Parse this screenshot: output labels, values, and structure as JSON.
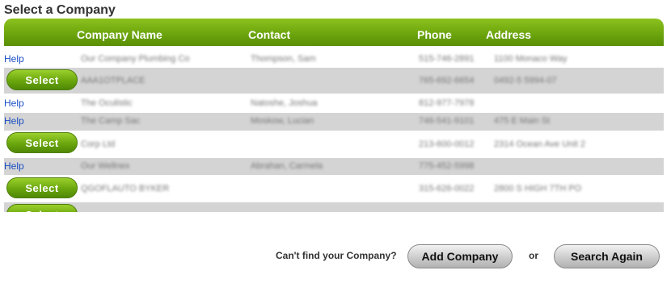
{
  "page_title": "Select a Company",
  "table": {
    "headers": {
      "name": "Company Name",
      "contact": "Contact",
      "phone": "Phone",
      "address": "Address"
    },
    "rows": [
      {
        "type": "help",
        "action": "Help",
        "name": "Our Company Plumbing Co",
        "contact": "Thompson, Sam",
        "phone": "515-746-2891",
        "address": "1100 Monaco Way"
      },
      {
        "type": "select",
        "action": "Select",
        "name": "AAA1OTPLACE",
        "contact": "",
        "phone": "765-692-6654",
        "address": "0492-5 5994-07"
      },
      {
        "type": "help",
        "action": "Help",
        "name": "The Oculistic",
        "contact": "Natoshe, Joshua",
        "phone": "812-977-7978",
        "address": ""
      },
      {
        "type": "help",
        "action": "Help",
        "name": "The Camp Sac",
        "contact": "Moskow, Lucian",
        "phone": "746-541-9101",
        "address": "475 E Main St"
      },
      {
        "type": "select",
        "action": "Select",
        "name": "Corp Ltd",
        "contact": "",
        "phone": "213-600-0012",
        "address": "2314 Ocean Ave Unit 2"
      },
      {
        "type": "help",
        "action": "Help",
        "name": "Our Wellnex",
        "contact": "Abrahan, Carmela",
        "phone": "775-452-5998",
        "address": ""
      },
      {
        "type": "select",
        "action": "Select",
        "name": "QGOFLAUTO BYKER",
        "contact": "",
        "phone": "315-626-0022",
        "address": "2800 S HIGH 7TH PO"
      },
      {
        "type": "select",
        "action": "Select",
        "name": "",
        "contact": "",
        "phone": "",
        "address": ""
      }
    ]
  },
  "footer": {
    "prompt": "Can't find your Company?",
    "add_label": "Add Company",
    "or_label": "or",
    "search_label": "Search Again"
  }
}
